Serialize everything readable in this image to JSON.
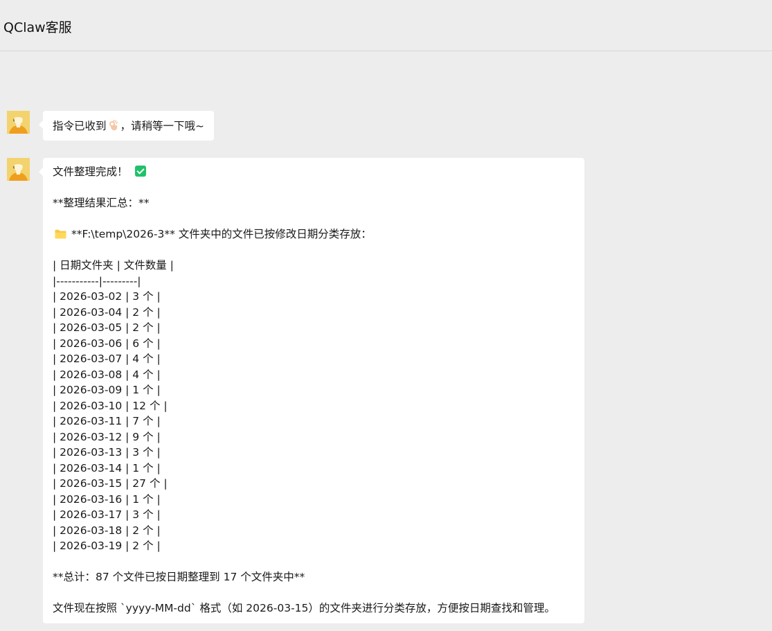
{
  "header": {
    "title": "QClaw客服"
  },
  "messages": [
    {
      "sender": "bot",
      "avatar_icon": "user-avatar-icon",
      "text_before": "指令已收到",
      "emoji": "ok-hand-icon",
      "text_after": "，请稍等一下哦~"
    },
    {
      "sender": "bot",
      "avatar_icon": "user-avatar-icon",
      "title": "文件整理完成！",
      "title_icon": "check-mark-icon",
      "summary_heading": "**整理结果汇总：**",
      "folder_icon": "folder-icon",
      "folder_line": "**F:\\temp\\2026-3** 文件夹中的文件已按修改日期分类存放：",
      "table_header": "| 日期文件夹 | 文件数量 |",
      "table_separator": "|-----------|---------|",
      "table_rows": [
        "| 2026-03-02 | 3 个 |",
        "| 2026-03-04 | 2 个 |",
        "| 2026-03-05 | 2 个 |",
        "| 2026-03-06 | 6 个 |",
        "| 2026-03-07 | 4 个 |",
        "| 2026-03-08 | 4 个 |",
        "| 2026-03-09 | 1 个 |",
        "| 2026-03-10 | 12 个 |",
        "| 2026-03-11 | 7 个 |",
        "| 2026-03-12 | 9 个 |",
        "| 2026-03-13 | 3 个 |",
        "| 2026-03-14 | 1 个 |",
        "| 2026-03-15 | 27 个 |",
        "| 2026-03-16 | 1 个 |",
        "| 2026-03-17 | 3 个 |",
        "| 2026-03-18 | 2 个 |",
        "| 2026-03-19 | 2 个 |"
      ],
      "total_line": "**总计：87 个文件已按日期整理到 17 个文件夹中**",
      "footer_line": "文件现在按照 `yyyy-MM-dd` 格式（如 2026-03-15）的文件夹进行分类存放，方便按日期查找和管理。"
    }
  ],
  "colors": {
    "background": "#ededed",
    "bubble": "#ffffff",
    "avatar": "#f3d36d",
    "check": "#1ec26a",
    "folder": "#f7c948"
  }
}
